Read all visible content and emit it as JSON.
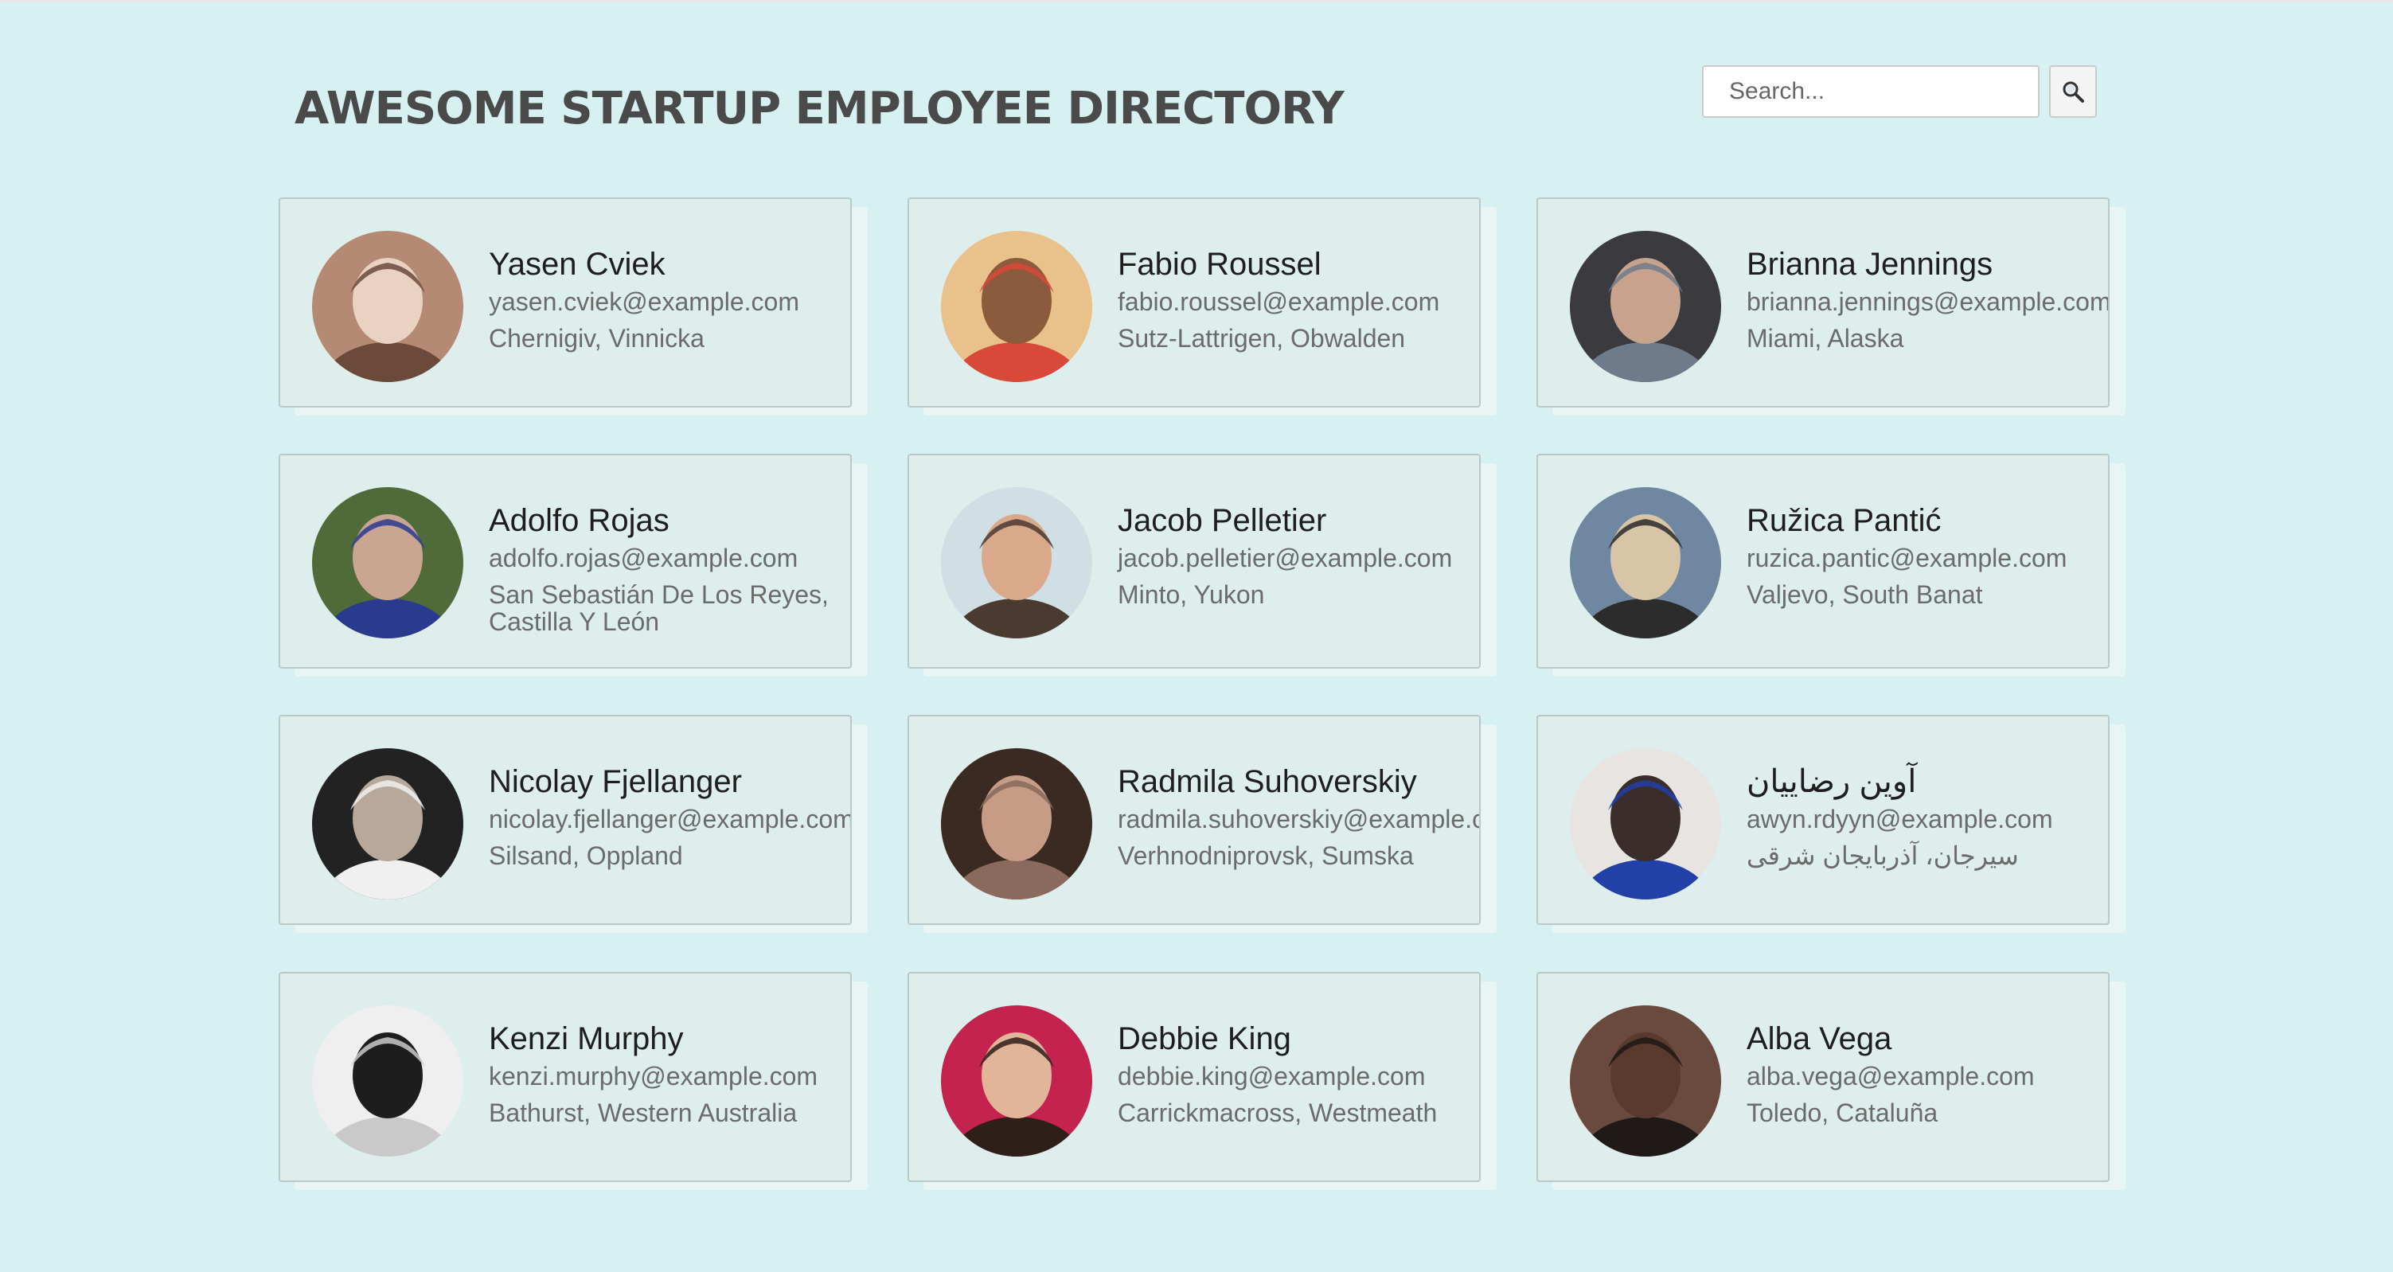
{
  "header": {
    "title": "AWESOME STARTUP EMPLOYEE DIRECTORY",
    "search": {
      "placeholder": "Search...",
      "value": ""
    },
    "search_button_icon": "magnifier-icon"
  },
  "employees": [
    {
      "name": "Yasen Cviek",
      "email": "yasen.cviek@example.com",
      "location": "Chernigiv, Vinnicka",
      "avatar_colors": [
        "#b48a74",
        "#e9d2c2",
        "#6b4a3c"
      ]
    },
    {
      "name": "Fabio Roussel",
      "email": "fabio.roussel@example.com",
      "location": "Sutz-Lattrigen, Obwalden",
      "avatar_colors": [
        "#e8c28a",
        "#8c5a3c",
        "#d9493a"
      ]
    },
    {
      "name": "Brianna Jennings",
      "email": "brianna.jennings@example.com",
      "location": "Miami, Alaska",
      "avatar_colors": [
        "#3b3a3f",
        "#c7a28c",
        "#6e7b8a"
      ]
    },
    {
      "name": "Adolfo Rojas",
      "email": "adolfo.rojas@example.com",
      "location": "San Sebastián De Los Reyes, Castilla Y León",
      "avatar_colors": [
        "#4f6b3a",
        "#c9a692",
        "#2a3b8f"
      ]
    },
    {
      "name": "Jacob Pelletier",
      "email": "jacob.pelletier@example.com",
      "location": "Minto, Yukon",
      "avatar_colors": [
        "#cfdfe3",
        "#d9a98a",
        "#4b3a30"
      ]
    },
    {
      "name": "Ružica Pantić",
      "email": "ruzica.pantic@example.com",
      "location": "Valjevo, South Banat",
      "avatar_colors": [
        "#6f87a0",
        "#d8c4a6",
        "#2c2c2c"
      ]
    },
    {
      "name": "Nicolay Fjellanger",
      "email": "nicolay.fjellanger@example.com",
      "location": "Silsand, Oppland",
      "avatar_colors": [
        "#222222",
        "#b7a899",
        "#f0f0f0"
      ]
    },
    {
      "name": "Radmila Suhoverskiy",
      "email": "radmila.suhoverskiy@example.com",
      "location": "Verhnodniprovsk, Sumska",
      "avatar_colors": [
        "#3b2a22",
        "#c79c86",
        "#8a6a5c"
      ]
    },
    {
      "name": "آوین رضاییان",
      "email": "awyn.rdyyn@example.com",
      "location": "سیرجان، آذربایجان شرقی",
      "avatar_colors": [
        "#e7e4e2",
        "#3a2d2a",
        "#2140a8"
      ]
    },
    {
      "name": "Kenzi Murphy",
      "email": "kenzi.murphy@example.com",
      "location": "Bathurst, Western Australia",
      "avatar_colors": [
        "#efefef",
        "#1d1d1d",
        "#c9c9c9"
      ]
    },
    {
      "name": "Debbie King",
      "email": "debbie.king@example.com",
      "location": "Carrickmacross, Westmeath",
      "avatar_colors": [
        "#c4224f",
        "#e2b49a",
        "#2e1f1a"
      ]
    },
    {
      "name": "Alba Vega",
      "email": "alba.vega@example.com",
      "location": "Toledo, Cataluña",
      "avatar_colors": [
        "#6a4a3f",
        "#5a3a2c",
        "#1f1a18"
      ]
    }
  ]
}
